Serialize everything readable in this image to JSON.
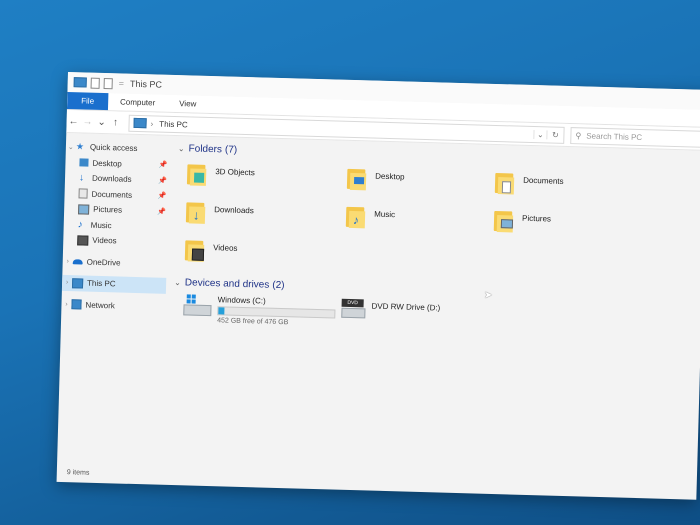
{
  "window": {
    "title": "This PC",
    "titlebar_separator": "=",
    "status": "9 items"
  },
  "ribbon": {
    "tabs": [
      "File",
      "Computer",
      "View"
    ]
  },
  "address": {
    "back": "←",
    "forward": "→",
    "recent": "⌄",
    "up": "↑",
    "chevron": "›",
    "path": "This PC",
    "dropdown": "⌄",
    "refresh": "↻",
    "search_placeholder": "Search This PC"
  },
  "nav": {
    "quick_access": "Quick access",
    "pinned": [
      {
        "label": "Desktop",
        "icon": "desktop-icon",
        "pinned": true
      },
      {
        "label": "Downloads",
        "icon": "downloads-icon",
        "pinned": true
      },
      {
        "label": "Documents",
        "icon": "documents-icon",
        "pinned": true
      },
      {
        "label": "Pictures",
        "icon": "pictures-icon",
        "pinned": true
      },
      {
        "label": "Music",
        "icon": "music-icon",
        "pinned": false
      },
      {
        "label": "Videos",
        "icon": "videos-icon",
        "pinned": false
      }
    ],
    "onedrive": "OneDrive",
    "this_pc": "This PC",
    "network": "Network"
  },
  "folders": {
    "heading": "Folders",
    "count": "(7)",
    "items": [
      {
        "label": "3D Objects",
        "badge": "3d-objects-icon"
      },
      {
        "label": "Desktop",
        "badge": "desktop-icon"
      },
      {
        "label": "Documents",
        "badge": "documents-icon"
      },
      {
        "label": "Downloads",
        "badge": "downloads-icon"
      },
      {
        "label": "Music",
        "badge": "music-icon"
      },
      {
        "label": "Pictures",
        "badge": "pictures-icon"
      },
      {
        "label": "Videos",
        "badge": "videos-icon"
      }
    ]
  },
  "drives": {
    "heading": "Devices and drives",
    "count": "(2)",
    "windows": {
      "label": "Windows (C:)",
      "free_text": "452 GB free of 476 GB",
      "used_fraction": 0.05
    },
    "dvd": {
      "label": "DVD RW Drive (D:)",
      "badge_text": "DVD"
    }
  },
  "colors": {
    "accent": "#1a6fcd",
    "heading": "#1e3287",
    "selection": "#cce4f7",
    "desktop": "#1a73b6"
  }
}
